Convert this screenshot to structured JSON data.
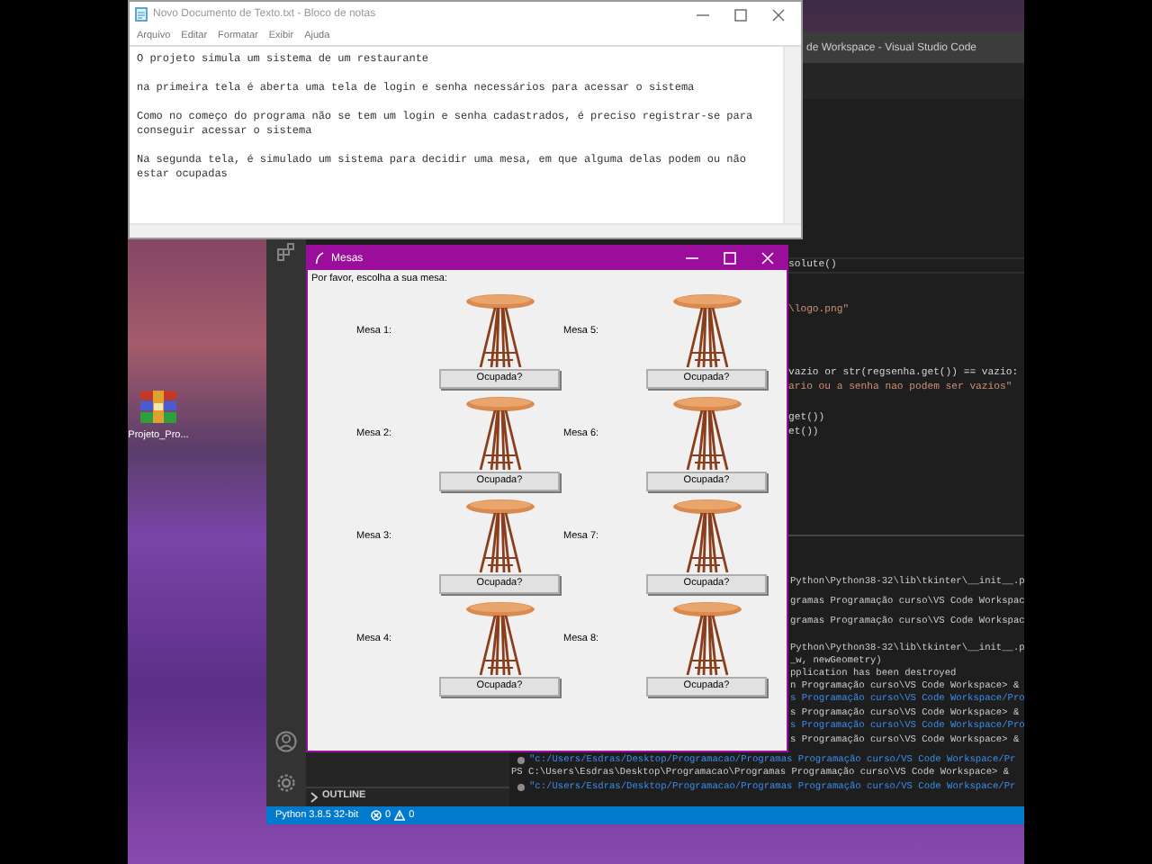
{
  "notepad": {
    "title": "Novo Documento de Texto.txt - Bloco de notas",
    "menu": [
      "Arquivo",
      "Editar",
      "Formatar",
      "Exibir",
      "Ajuda"
    ],
    "paragraphs": [
      {
        "lines": [
          "O projeto simula um sistema de um restaurante"
        ]
      },
      {
        "lines": [
          "na primeira tela é aberta uma tela de login e senha necessários para acessar o sistema"
        ]
      },
      {
        "lines": [
          "Como no começo do programa não se tem um login e senha cadastrados, é preciso registrar-se para",
          "conseguir acessar o sistema"
        ]
      },
      {
        "lines": [
          "Na segunda tela, é simulado um sistema para decidir uma mesa, em que alguma delas podem ou não",
          "estar ocupadas"
        ]
      }
    ]
  },
  "desktop_icons": [
    {
      "label": "Projeto_Pro..."
    }
  ],
  "vscode": {
    "title": "de Workspace - Visual Studio Code",
    "code_lines": [
      {
        "text": "solute()",
        "kind": "code"
      },
      {
        "text": "\\logo.png\"",
        "kind": "string"
      },
      {
        "text": "vazio or str(regsenha.get()) == vazio:",
        "kind": "code"
      },
      {
        "text": "ario ou a senha nao podem ser vazios\"",
        "kind": "string"
      },
      {
        "text": "get())",
        "kind": "code"
      },
      {
        "text": "et())",
        "kind": "code"
      }
    ],
    "terminal_lines": [
      {
        "text": "Python\\Python38-32\\lib\\tkinter\\__init__.p",
        "kind": "plain"
      },
      {
        "text": "gramas Programação curso\\VS Code Workspac",
        "kind": "plain"
      },
      {
        "text": "gramas Programação curso\\VS Code Workspac",
        "kind": "plain"
      },
      {
        "text": "Python\\Python38-32\\lib\\tkinter\\__init__.p",
        "kind": "plain"
      },
      {
        "text": "_w, newGeometry)",
        "kind": "plain"
      },
      {
        "text": "pplication has been destroyed",
        "kind": "plain"
      },
      {
        "text": "n Programação curso\\VS Code Workspace> &",
        "kind": "plain"
      },
      {
        "text": "s Programação curso\\VS Code Workspace/Pro",
        "kind": "path"
      },
      {
        "text": "s Programação curso\\VS Code Workspace> &",
        "kind": "plain"
      },
      {
        "text": "s Programação curso\\VS Code Workspace/Pro",
        "kind": "path"
      },
      {
        "text": "s Programação curso\\VS Code Workspace> &",
        "kind": "plain"
      }
    ],
    "terminal_full_lines": [
      {
        "text": "\"c:/Users/Esdras/Desktop/Programacao/Programas Programação curso/VS Code Workspace/Pr",
        "kind": "command"
      },
      {
        "text": "PS C:\\Users\\Esdras\\Desktop\\Programacao\\Programas Programação curso\\VS Code Workspace> &",
        "kind": "plain"
      },
      {
        "text": "\"c:/Users/Esdras/Desktop/Programacao/Programas Programação curso/VS Code Workspace/Pr",
        "kind": "command"
      }
    ],
    "outline": "OUTLINE",
    "status_bar": {
      "interpreter": "Python 3.8.5 32-bit",
      "errors": "0",
      "warnings": "0"
    }
  },
  "mesas": {
    "title": "Mesas",
    "prompt": "Por favor, escolha a sua mesa:",
    "tables": [
      {
        "label": "Mesa 1:",
        "button": "Ocupada?"
      },
      {
        "label": "Mesa 2:",
        "button": "Ocupada?"
      },
      {
        "label": "Mesa 3:",
        "button": "Ocupada?"
      },
      {
        "label": "Mesa 4:",
        "button": "Ocupada?"
      },
      {
        "label": "Mesa 5:",
        "button": "Ocupada?"
      },
      {
        "label": "Mesa 6:",
        "button": "Ocupada?"
      },
      {
        "label": "Mesa 7:",
        "button": "Ocupada?"
      },
      {
        "label": "Mesa 8:",
        "button": "Ocupada?"
      }
    ]
  }
}
